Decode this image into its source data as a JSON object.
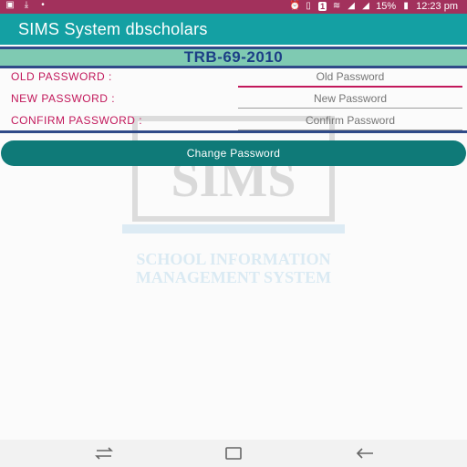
{
  "statusbar": {
    "notification_badge": "1",
    "battery": "15%",
    "time": "12:23 pm"
  },
  "appbar": {
    "title": "SIMS System dbscholars"
  },
  "banner": {
    "text": "TRB-69-2010"
  },
  "form": {
    "old_password": {
      "label": "OLD PASSWORD :",
      "placeholder": "Old Password"
    },
    "new_password": {
      "label": "NEW PASSWORD :",
      "placeholder": "New Password"
    },
    "confirm_password": {
      "label": "CONFIRM PASSWORD :",
      "placeholder": "Confirm Password"
    }
  },
  "actions": {
    "change_password_label": "Change Password"
  },
  "watermark": {
    "logo_text": "SIMS",
    "line1": "SCHOOL INFORMATION",
    "line2": "MANAGEMENT SYSTEM"
  },
  "colors": {
    "statusbar": "#a2315c",
    "appbar": "#14a0a3",
    "banner": "#7fcab2",
    "banner_border": "#2f4a88",
    "label": "#c2185b",
    "button": "#0f7a78"
  }
}
